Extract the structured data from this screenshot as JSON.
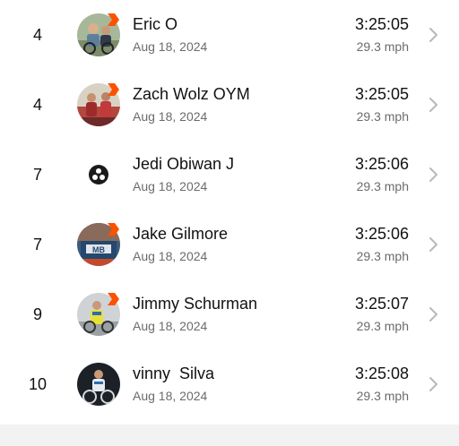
{
  "rows": [
    {
      "rank": "4",
      "name": "Eric O",
      "date": "Aug 18, 2024",
      "time": "3:25:05",
      "speed": "29.3 mph",
      "avatar": "photo-avatar",
      "badge": true
    },
    {
      "rank": "4",
      "name": "Zach Wolz OYM",
      "date": "Aug 18, 2024",
      "time": "3:25:05",
      "speed": "29.3 mph",
      "avatar": "photo-avatar",
      "badge": true
    },
    {
      "rank": "7",
      "name": "Jedi Obiwan J",
      "date": "Aug 18, 2024",
      "time": "3:25:06",
      "speed": "29.3 mph",
      "avatar": "logo-avatar",
      "badge": false
    },
    {
      "rank": "7",
      "name": "Jake Gilmore",
      "date": "Aug 18, 2024",
      "time": "3:25:06",
      "speed": "29.3 mph",
      "avatar": "photo-avatar",
      "badge": true
    },
    {
      "rank": "9",
      "name": "Jimmy Schurman",
      "date": "Aug 18, 2024",
      "time": "3:25:07",
      "speed": "29.3 mph",
      "avatar": "photo-avatar",
      "badge": true
    },
    {
      "rank": "10",
      "name": "vinny  Silva",
      "date": "Aug 18, 2024",
      "time": "3:25:08",
      "speed": "29.3 mph",
      "avatar": "photo-avatar",
      "badge": false
    }
  ],
  "colors": {
    "badge": "#fc5200",
    "secondary_text": "#6b6b6b",
    "chevron": "#b8b8b8"
  }
}
